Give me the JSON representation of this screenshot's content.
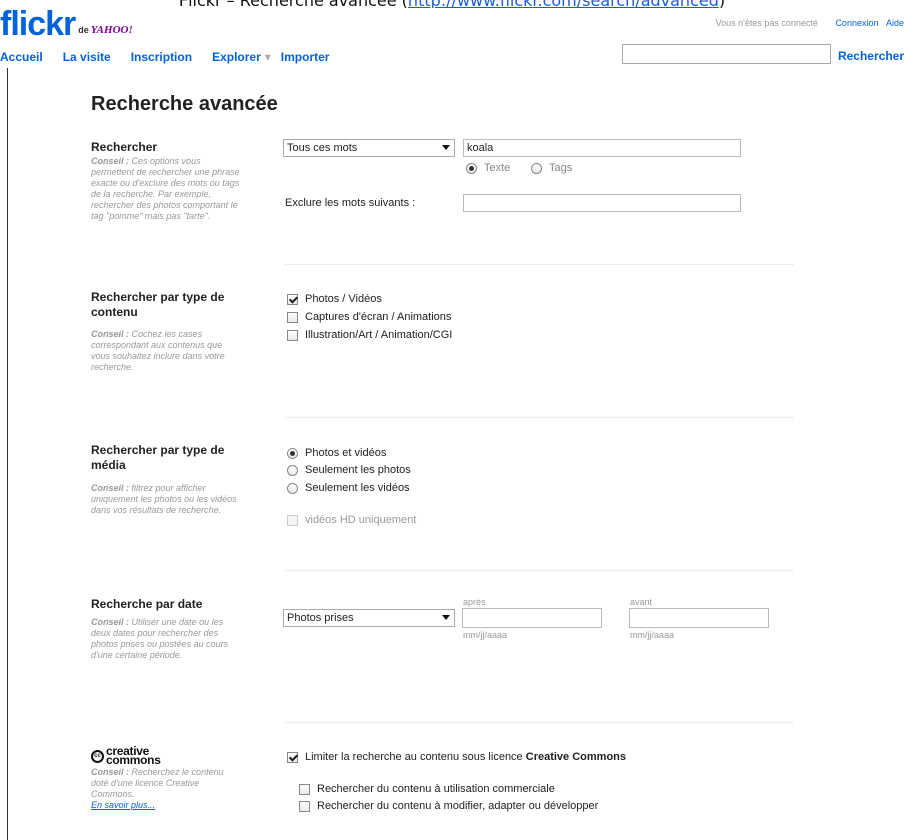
{
  "caption": {
    "prefix": "Flickr – Recherche avancée (",
    "link": "http://www.flickr.com/search/advanced",
    "suffix": ")"
  },
  "brand": {
    "logo": "flickr",
    "sub": "de",
    "yahoo": "YAHOO!"
  },
  "topbar": {
    "status": "Vous n'êtes pas connecté",
    "login": "Connexion",
    "help": "Aide"
  },
  "nav": {
    "items": [
      "Accueil",
      "La visite",
      "Inscription",
      "Explorer",
      "Importer"
    ],
    "separator": "▾",
    "search_button": "Rechercher",
    "search_value": ""
  },
  "page_title": "Recherche avancée",
  "search": {
    "title": "Rechercher",
    "tip_label": "Conseil :",
    "tip": "Ces options vous permettent de rechercher une phrase exacte ou d'exclure des mots ou tags de la recherche. Par exemple, rechercher des photos comportant le tag \"pomme\" mais pas \"tarte\".",
    "mode_select": "Tous ces mots",
    "query": "koala",
    "scope_options": [
      "Texte",
      "Tags"
    ],
    "scope_selected": "Texte",
    "exclude_label": "Exclure les mots suivants :",
    "exclude_value": ""
  },
  "content_type": {
    "title": "Rechercher par type de contenu",
    "tip_label": "Conseil :",
    "tip": "Cochez les cases correspondant aux contenus que vous souhaitez inclure dans votre recherche.",
    "options": [
      {
        "label": "Photos / Vidéos",
        "checked": true
      },
      {
        "label": "Captures d'écran / Animations",
        "checked": false
      },
      {
        "label": "Illustration/Art / Animation/CGI",
        "checked": false
      }
    ]
  },
  "media_type": {
    "title": "Rechercher par type de média",
    "tip_label": "Conseil :",
    "tip": "filtrez pour afficher uniquement les photos ou les vidéos dans vos résultats de recherche.",
    "options": [
      "Photos et vidéos",
      "Seulement les photos",
      "Seulement les vidéos"
    ],
    "selected": "Photos et vidéos",
    "hd_label": "vidéos HD uniquement"
  },
  "date": {
    "title": "Recherche par date",
    "tip_label": "Conseil :",
    "tip": "Utiliser une date ou les deux dates pour rechercher des photos prises ou postées au cours d'une certaine période.",
    "mode_select": "Photos prises",
    "after_label": "après",
    "before_label": "avant",
    "format_hint": "mm/jj/aaaa",
    "after_value": "",
    "before_value": ""
  },
  "cc": {
    "logo_icon": "cc",
    "logo_text_1": "creative",
    "logo_text_2": "commons",
    "tip_label": "Conseil :",
    "tip": "Recherchez le contenu doté d'une licence Creative Commons.",
    "learn_more": "En savoir plus...",
    "main_label": "Limiter la recherche au contenu sous licence",
    "main_label_bold": "Creative Commons",
    "main_checked": true,
    "sub_options": [
      {
        "label": "Rechercher du contenu à utilisation commerciale",
        "checked": false
      },
      {
        "label": "Rechercher du contenu à modifier, adapter ou développer",
        "checked": false
      }
    ]
  },
  "colors": {
    "brand_blue": "#0063dc",
    "brand_pink": "#ff0084",
    "yahoo_purple": "#7b0099"
  },
  "icons": [
    "dropdown-arrow-icon",
    "checkbox-icon",
    "radio-icon",
    "creative-commons-icon"
  ]
}
